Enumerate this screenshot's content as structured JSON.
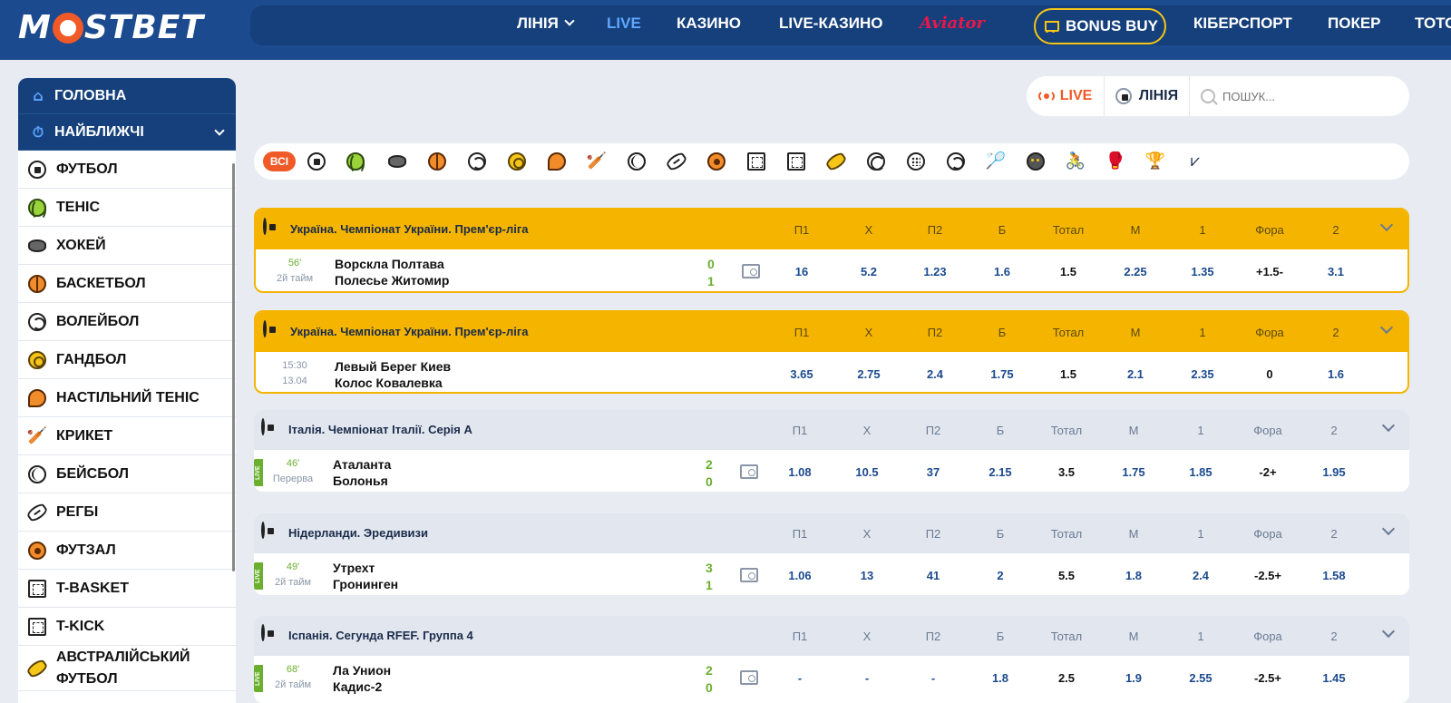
{
  "brand": {
    "logo_left": "M",
    "logo_right": "STBET"
  },
  "nav": {
    "items": [
      "ЛІНІЯ",
      "LIVE",
      "КАЗИНО",
      "LIVE-КАЗИНО",
      "Aviator"
    ],
    "bonus": "BONUS BUY",
    "items_right": [
      "КІБЕРСПОРТ",
      "ПОКЕР",
      "ТОТО"
    ]
  },
  "sidebar": {
    "top": [
      "ГОЛОВНА",
      "НАЙБЛИЖЧІ"
    ],
    "sports": [
      {
        "label": "ФУТБОЛ",
        "icon": "soccer-ball-icon"
      },
      {
        "label": "ТЕНІС",
        "icon": "tennis-ball-icon"
      },
      {
        "label": "ХОКЕЙ",
        "icon": "hockey-puck-icon"
      },
      {
        "label": "БАСКЕТБОЛ",
        "icon": "basketball-icon"
      },
      {
        "label": "ВОЛЕЙБОЛ",
        "icon": "volleyball-icon"
      },
      {
        "label": "ГАНДБОЛ",
        "icon": "handball-icon"
      },
      {
        "label": "НАСТІЛЬНИЙ ТЕНІС",
        "icon": "table-tennis-icon"
      },
      {
        "label": "КРИКЕТ",
        "icon": "cricket-icon"
      },
      {
        "label": "БЕЙСБОЛ",
        "icon": "baseball-icon"
      },
      {
        "label": "РЕГБІ",
        "icon": "rugby-ball-icon"
      },
      {
        "label": "ФУТЗАЛ",
        "icon": "futsal-ball-icon"
      },
      {
        "label": "T-BASKET",
        "icon": "t-basket-icon"
      },
      {
        "label": "T-KICK",
        "icon": "t-kick-icon"
      },
      {
        "label": "АВСТРАЛІЙСЬКИЙ ФУТБОЛ",
        "icon": "australian-football-icon"
      }
    ]
  },
  "filter": {
    "live": "LIVE",
    "line": "ЛІНІЯ",
    "search_placeholder": "ПОШУК..."
  },
  "sports_bar": {
    "all": "ВСІ"
  },
  "columns": [
    "П1",
    "Х",
    "П2",
    "Б",
    "Тотал",
    "М",
    "1",
    "Фора",
    "2"
  ],
  "matches": [
    {
      "league": "Україна. Чемпіонат України. Прем'єр-ліга",
      "featured": true,
      "live": false,
      "time1": "56'",
      "time2": "2й тайм",
      "team1": "Ворскла Полтава",
      "team2": "Полесье Житомир",
      "score1": "0",
      "score2": "1",
      "field": true,
      "odds": [
        "16",
        "5.2",
        "1.23",
        "1.6",
        "1.5",
        "2.25",
        "1.35",
        "+1.5-",
        "3.1"
      ]
    },
    {
      "league": "Україна. Чемпіонат України. Прем'єр-ліга",
      "featured": true,
      "live": false,
      "time1": "15:30",
      "time2": "13.04",
      "team1": "Левый Берег Киев",
      "team2": "Колос Ковалевка",
      "score1": "",
      "score2": "",
      "field": false,
      "odds": [
        "3.65",
        "2.75",
        "2.4",
        "1.75",
        "1.5",
        "2.1",
        "2.35",
        "0",
        "1.6"
      ]
    },
    {
      "league": "Італія. Чемпіонат Італії. Серія А",
      "featured": false,
      "live": true,
      "time1": "46'",
      "time2": "Перерва",
      "team1": "Аталанта",
      "team2": "Болонья",
      "score1": "2",
      "score2": "0",
      "field": true,
      "odds": [
        "1.08",
        "10.5",
        "37",
        "2.15",
        "3.5",
        "1.75",
        "1.85",
        "-2+",
        "1.95"
      ]
    },
    {
      "league": "Нідерланди. Эредивизи",
      "featured": false,
      "live": true,
      "time1": "49'",
      "time2": "2й тайм",
      "team1": "Утрехт",
      "team2": "Гронинген",
      "score1": "3",
      "score2": "1",
      "field": true,
      "odds": [
        "1.06",
        "13",
        "41",
        "2",
        "5.5",
        "1.8",
        "2.4",
        "-2.5+",
        "1.58"
      ]
    },
    {
      "league": "Іспанія. Сегунда RFEF. Группа 4",
      "featured": false,
      "live": true,
      "time1": "68'",
      "time2": "2й тайм",
      "team1": "Ла Унион",
      "team2": "Кадис-2",
      "score1": "2",
      "score2": "0",
      "field": true,
      "odds": [
        "-",
        "-",
        "-",
        "1.8",
        "2.5",
        "1.9",
        "2.55",
        "-2.5+",
        "1.45"
      ]
    }
  ],
  "live_tag": "LIVE"
}
